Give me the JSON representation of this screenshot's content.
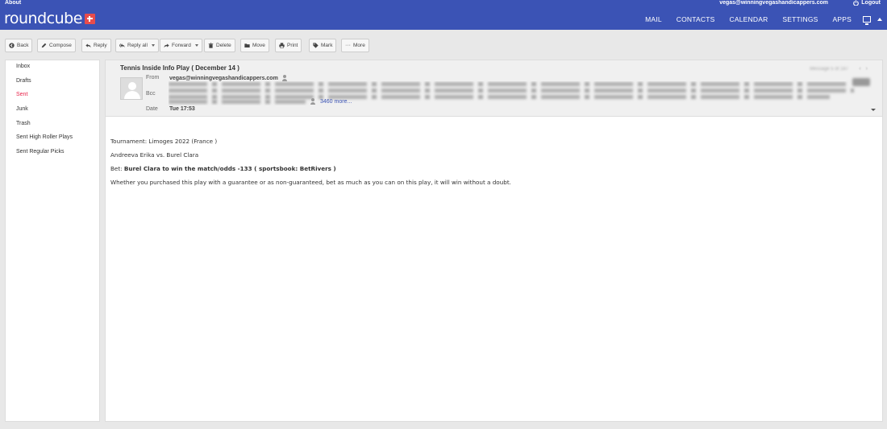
{
  "topbar": {
    "about": "About",
    "user_email": "vegas@winningvegashandicappers.com",
    "logout": "Logout",
    "logo": "roundcube",
    "nav": [
      "MAIL",
      "CONTACTS",
      "CALENDAR",
      "SETTINGS",
      "APPS"
    ],
    "icons": [
      "monitor-icon",
      "caret-up-icon",
      "power-icon"
    ]
  },
  "toolbar": {
    "back": "Back",
    "compose": "Compose",
    "reply": "Reply",
    "reply_all": "Reply all",
    "forward": "Forward",
    "delete": "Delete",
    "move": "Move",
    "print": "Print",
    "mark": "Mark",
    "more": "More"
  },
  "folders": [
    "Inbox",
    "Drafts",
    "Sent",
    "Junk",
    "Trash",
    "Sent High Roller Plays",
    "Sent Regular Picks"
  ],
  "active_folder": "Sent",
  "colors": {
    "topbar": "#3b53b5",
    "active_folder": "#e8234a",
    "logo_badge": "#e84c4c",
    "link": "#3b53b5"
  },
  "message": {
    "subject": "Tennis Inside Info Play ( December 14 )",
    "from_label": "From",
    "from": "vegas@winningvegashandicappers.com",
    "bcc_label": "Bcc",
    "bcc_more": "3460 more...",
    "date_label": "Date",
    "date": "Tue 17:53",
    "body": {
      "tournament": "Tournament: Limoges 2022 (France )",
      "match": "Andreeva Erika vs. Burel Clara",
      "bet_label": "Bet:",
      "bet": "Burel Clara to win the match/odds -133 ( sportsbook: BetRivers )",
      "note": "Whether you purchased this play with a guarantee or as non-guaranteed, bet as much as you can on this play, it will win without a doubt."
    }
  }
}
